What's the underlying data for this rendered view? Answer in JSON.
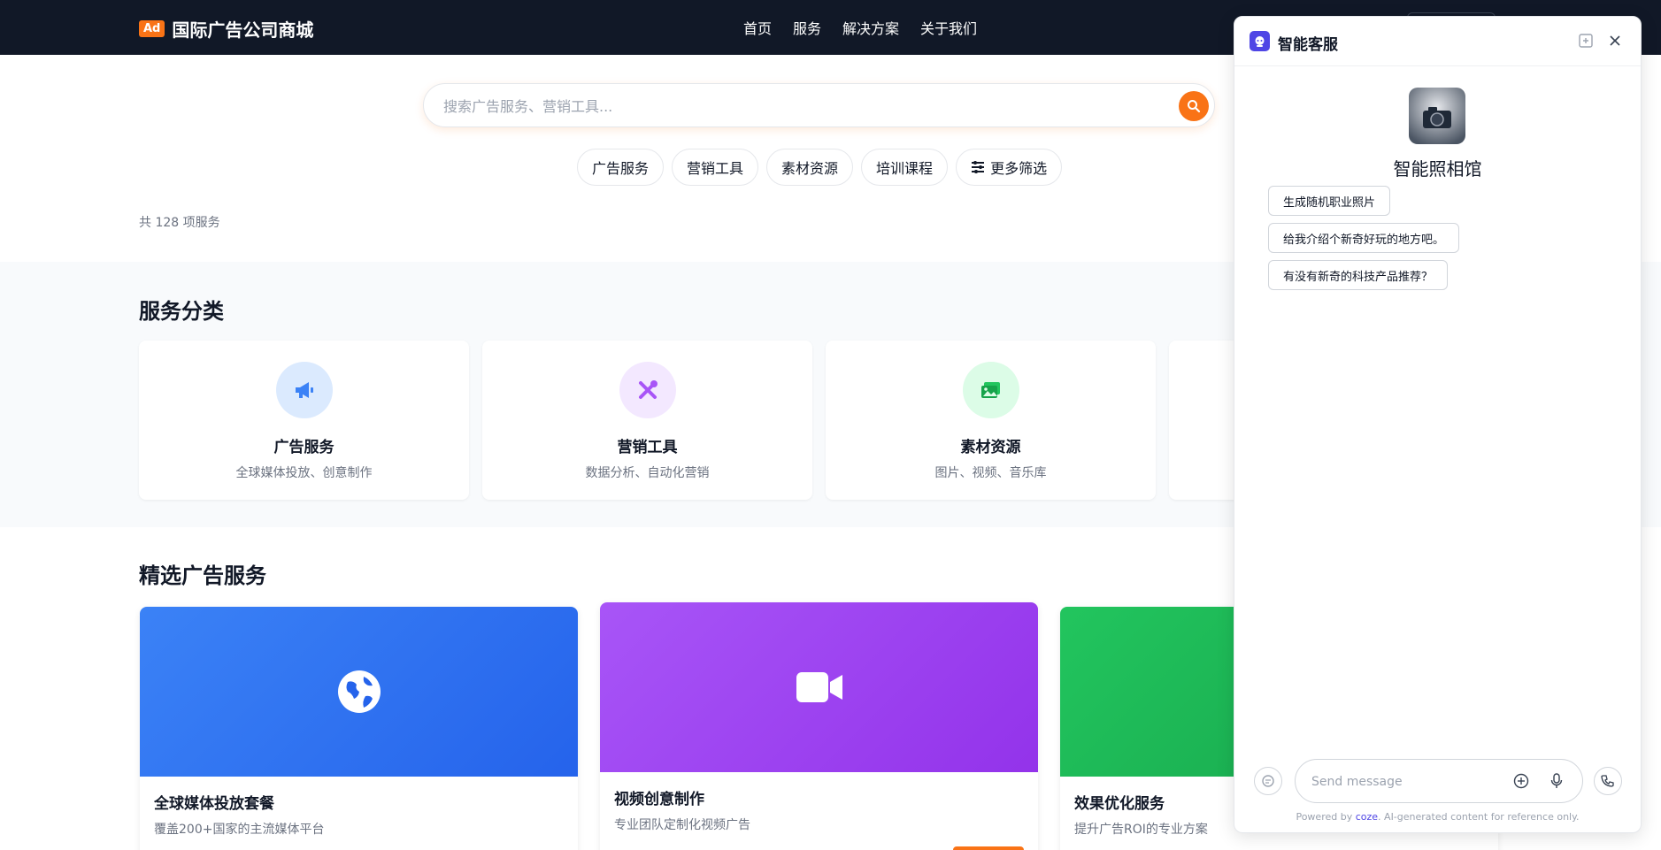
{
  "header": {
    "logo_badge": "Ad",
    "logo_text": "国际广告公司商城",
    "nav": [
      "首页",
      "服务",
      "解决方案",
      "关于我们"
    ]
  },
  "search": {
    "placeholder": "搜索广告服务、营销工具..."
  },
  "filters": [
    "广告服务",
    "营销工具",
    "素材资源",
    "培训课程",
    "更多筛选"
  ],
  "result_count": "共 128 项服务",
  "categories": {
    "title": "服务分类",
    "items": [
      {
        "title": "广告服务",
        "desc": "全球媒体投放、创意制作",
        "icon": "megaphone-icon",
        "color": "#3b82f6",
        "bg": "#dbeafe"
      },
      {
        "title": "营销工具",
        "desc": "数据分析、自动化营销",
        "icon": "tools-icon",
        "color": "#a855f7",
        "bg": "#f3e8ff"
      },
      {
        "title": "素材资源",
        "desc": "图片、视频、音乐库",
        "icon": "images-icon",
        "color": "#22c55e",
        "bg": "#dcfce7"
      }
    ]
  },
  "featured": {
    "title": "精选广告服务",
    "items": [
      {
        "title": "全球媒体投放套餐",
        "desc": "覆盖200+国家的主流媒体平台",
        "icon": "globe-icon",
        "color_from": "#3b82f6",
        "color_to": "#2563eb"
      },
      {
        "title": "视频创意制作",
        "desc": "专业团队定制化视频广告",
        "icon": "video-icon",
        "color_from": "#a855f7",
        "color_to": "#9333ea"
      },
      {
        "title": "效果优化服务",
        "desc": "提升广告ROI的专业方案",
        "icon": "chart-icon",
        "color_from": "#22c55e",
        "color_to": "#16a34a"
      }
    ]
  },
  "chat": {
    "title": "智能客服",
    "bot_name": "智能照相馆",
    "suggestions": [
      "生成随机职业照片",
      "给我介绍个新奇好玩的地方吧。",
      "有没有新奇的科技产品推荐？"
    ],
    "input_placeholder": "Send message",
    "footer_prefix": "Powered by ",
    "footer_brand": "coze",
    "footer_suffix": ". AI-generated content for reference only."
  }
}
